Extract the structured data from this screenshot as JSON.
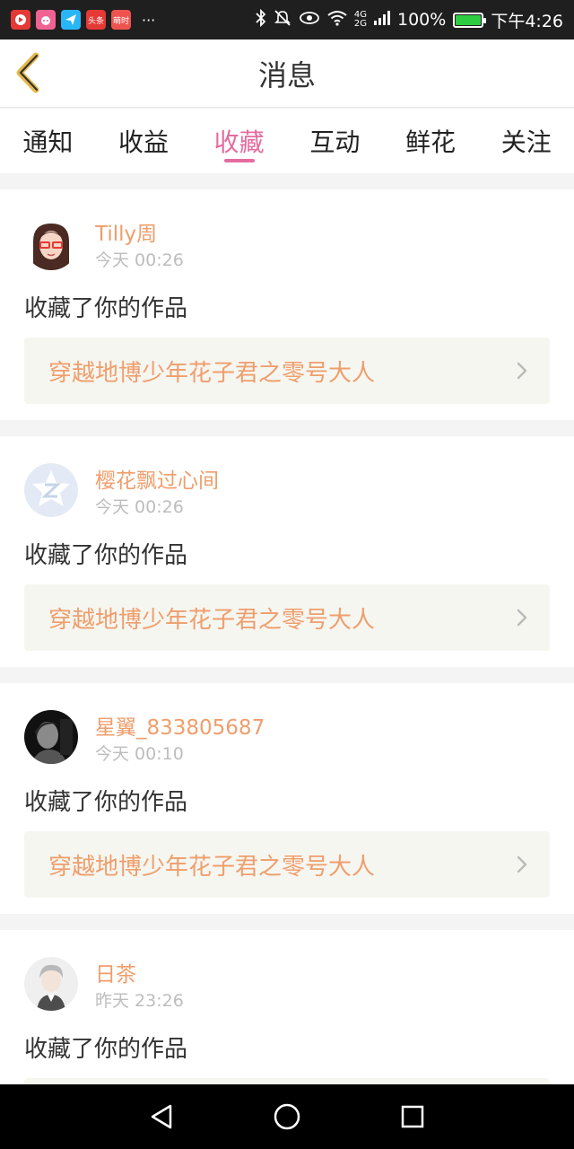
{
  "status_bar": {
    "notification_icons": [
      {
        "name": "video-app-icon",
        "color": "#e53935",
        "text": ""
      },
      {
        "name": "pig-app-icon",
        "color": "#f06292",
        "text": ""
      },
      {
        "name": "send-app-icon",
        "color": "#29b6f6",
        "text": ""
      },
      {
        "name": "toutiao-app-icon",
        "color": "#e53935",
        "text": "头条"
      },
      {
        "name": "app-icon",
        "color": "#ef5350",
        "text": "萌时"
      }
    ],
    "more": "···",
    "network": "4G\n2G",
    "battery": "100%",
    "time": "下午4:26"
  },
  "header": {
    "title": "消息"
  },
  "tabs": [
    {
      "label": "通知",
      "active": false
    },
    {
      "label": "收益",
      "active": false
    },
    {
      "label": "收藏",
      "active": true
    },
    {
      "label": "互动",
      "active": false
    },
    {
      "label": "鲜花",
      "active": false
    },
    {
      "label": "关注",
      "active": false
    }
  ],
  "feed": [
    {
      "user": "Tilly周",
      "time": "今天 00:26",
      "action": "收藏了你的作品",
      "work": "穿越地博少年花子君之零号大人",
      "avatar": "girl-avatar"
    },
    {
      "user": "樱花飘过心间",
      "time": "今天 00:26",
      "action": "收藏了你的作品",
      "work": "穿越地博少年花子君之零号大人",
      "avatar": "default-avatar"
    },
    {
      "user": "星翼_833805687",
      "time": "今天 00:10",
      "action": "收藏了你的作品",
      "work": "穿越地博少年花子君之零号大人",
      "avatar": "dark-avatar"
    },
    {
      "user": "日茶",
      "time": "昨天 23:26",
      "action": "收藏了你的作品",
      "work": "",
      "avatar": "boy-avatar"
    }
  ],
  "colors": {
    "accent": "#e46ca1",
    "username": "#ef9e6c",
    "work_bg": "#f6f6f1"
  }
}
